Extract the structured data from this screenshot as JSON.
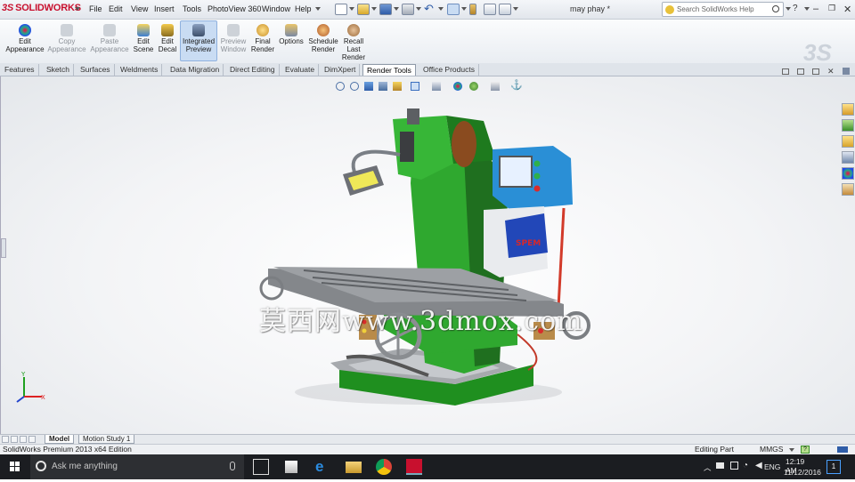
{
  "app": {
    "logo_text": "SOLIDWORKS",
    "menu": [
      "File",
      "Edit",
      "View",
      "Insert",
      "Tools",
      "PhotoView 360",
      "Window",
      "Help"
    ],
    "document_title": "may phay *",
    "search_placeholder": "Search SolidWorks Help"
  },
  "command_manager": {
    "buttons": [
      {
        "label": "Edit\nAppearance",
        "enabled": true,
        "color": "#d23a2a"
      },
      {
        "label": "Copy\nAppearance",
        "enabled": false,
        "color": "#bcc2c9"
      },
      {
        "label": "Paste\nAppearance",
        "enabled": false,
        "color": "#bcc2c9"
      },
      {
        "label": "Edit\nScene",
        "enabled": true,
        "color": "#3c7fd1"
      },
      {
        "label": "Edit\nDecal",
        "enabled": true,
        "color": "#d8a521"
      },
      {
        "label": "Integrated\nPreview",
        "enabled": true,
        "active": true,
        "color": "#5a6f8c"
      },
      {
        "label": "Preview\nWindow",
        "enabled": false,
        "color": "#bcc2c9"
      },
      {
        "label": "Final\nRender",
        "enabled": true,
        "color": "#c8902a"
      },
      {
        "label": "Options",
        "enabled": true,
        "color": "#7a8aa3"
      },
      {
        "label": "Schedule\nRender",
        "enabled": true,
        "color": "#b05b2a"
      },
      {
        "label": "Recall\nLast\nRender",
        "enabled": true,
        "color": "#9b6a3a"
      }
    ]
  },
  "tabs": {
    "items": [
      "Features",
      "Sketch",
      "Surfaces",
      "Weldments",
      "Data Migration",
      "Direct Editing",
      "Evaluate",
      "DimXpert",
      "Render Tools",
      "Office Products"
    ],
    "selected": "Render Tools"
  },
  "viewport": {
    "watermark": "莫西网www.3dmox.com",
    "triad_labels": {
      "y": "Y",
      "x": "X"
    },
    "machine_label": "SPEM"
  },
  "bottom_tabs": {
    "items": [
      "Model",
      "Motion Study 1"
    ],
    "selected": "Model"
  },
  "status": {
    "left": "SolidWorks Premium 2013 x64 Edition",
    "mode": "Editing Part",
    "units": "MMGS"
  },
  "taskbar": {
    "search_placeholder": "Ask me anything",
    "language": "ENG",
    "time": "12:19 AM",
    "date": "11/12/2016",
    "notification_count": "1"
  },
  "colors": {
    "machine_green": "#2fa82f",
    "machine_dark": "#1f6f1f",
    "table_gray": "#8c8f93",
    "panel_blue": "#2a8fd6",
    "accent_red": "#c8102e"
  }
}
